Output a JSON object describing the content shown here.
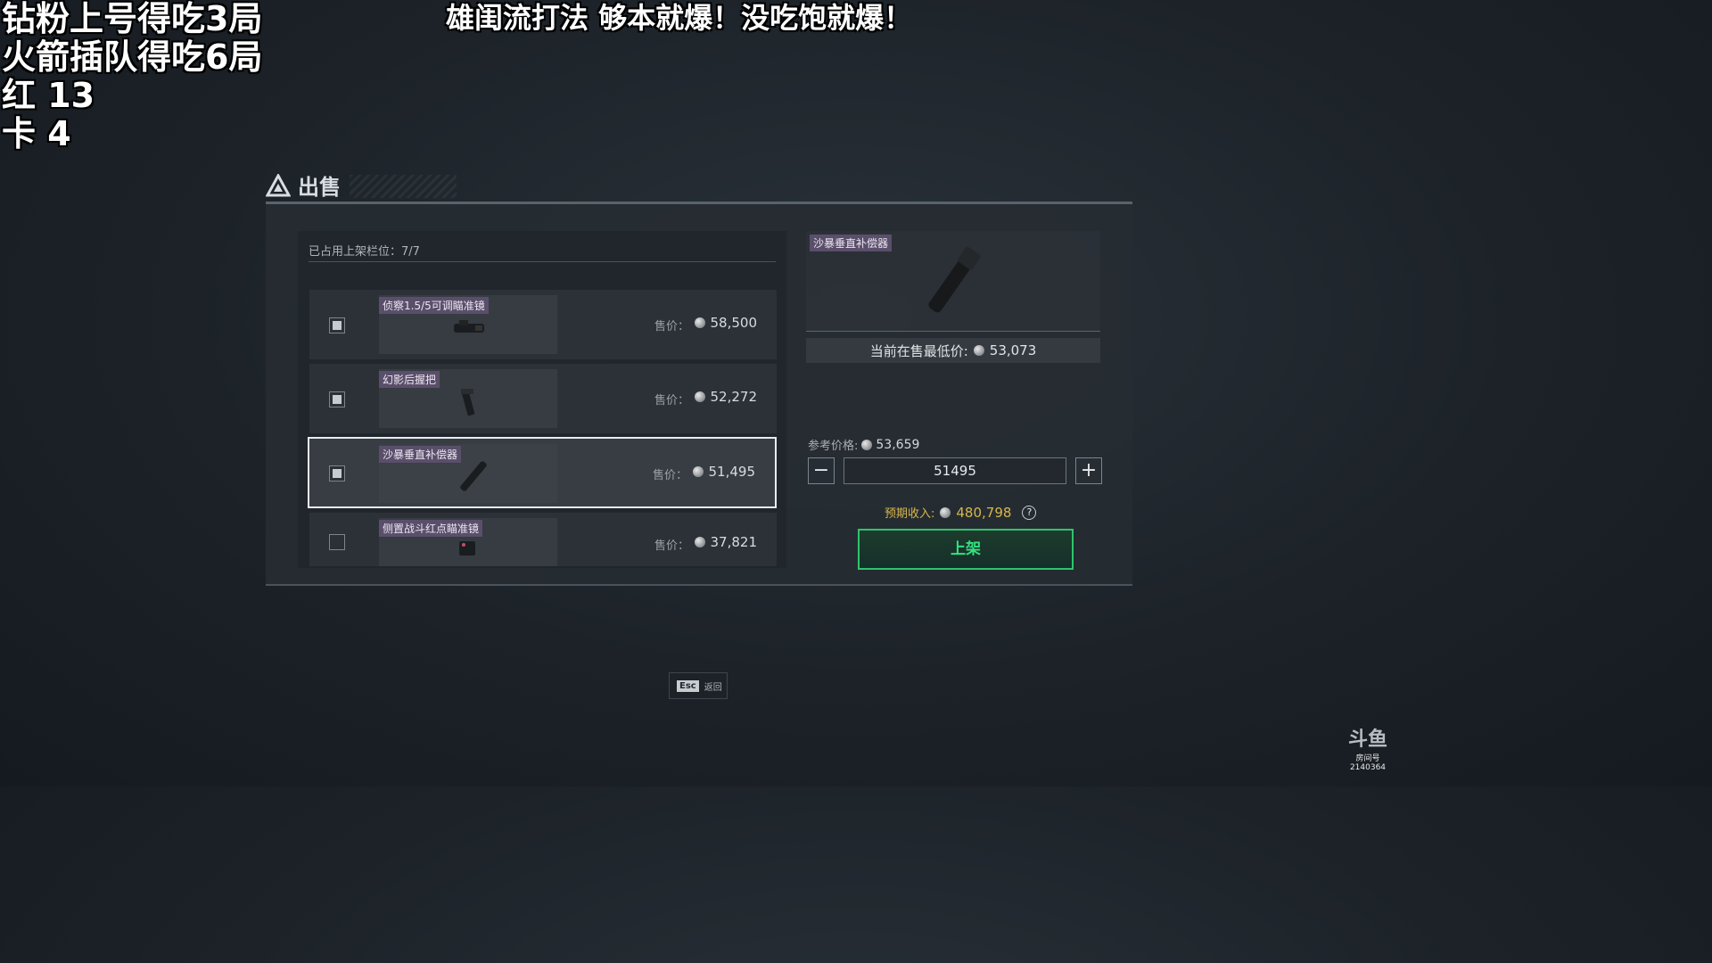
{
  "stream_overlay": {
    "left_lines": [
      "钻粉上号得吃3局",
      "火箭插队得吃6局",
      "红 13",
      "卡 4"
    ],
    "top_banner": "雄闺流打法 够本就爆！没吃饱就爆！"
  },
  "panel": {
    "title": "出售",
    "slots_label": "已占用上架栏位：7/7"
  },
  "items": [
    {
      "name": "侦察1.5/5可调瞄准镜",
      "price_label": "售价：",
      "price": "58,500",
      "checked": true,
      "selected": false
    },
    {
      "name": "幻影后握把",
      "price_label": "售价：",
      "price": "52,272",
      "checked": true,
      "selected": false
    },
    {
      "name": "沙暴垂直补偿器",
      "price_label": "售价：",
      "price": "51,495",
      "checked": true,
      "selected": true
    },
    {
      "name": "侧置战斗红点瞄准镜",
      "price_label": "售价：",
      "price": "37,821",
      "checked": false,
      "selected": false
    }
  ],
  "detail": {
    "item_name": "沙暴垂直补偿器",
    "lowest_label": "当前在售最低价:",
    "lowest_price": "53,073",
    "ref_label": "参考价格:",
    "ref_price": "53,659",
    "minus": "−",
    "plus": "+",
    "input_value": "51495",
    "income_label": "预期收入:",
    "income_value": "480,798",
    "help": "?",
    "list_button": "上架"
  },
  "footer": {
    "esc_key": "Esc",
    "esc_label": "返回"
  },
  "watermark": {
    "logo": "斗鱼",
    "room_label": "房间号",
    "room_id": "2140364"
  },
  "colors": {
    "accent_green": "#2ec46c",
    "income_gold": "#d8b64c",
    "tag_purple": "#5a4f6a"
  }
}
